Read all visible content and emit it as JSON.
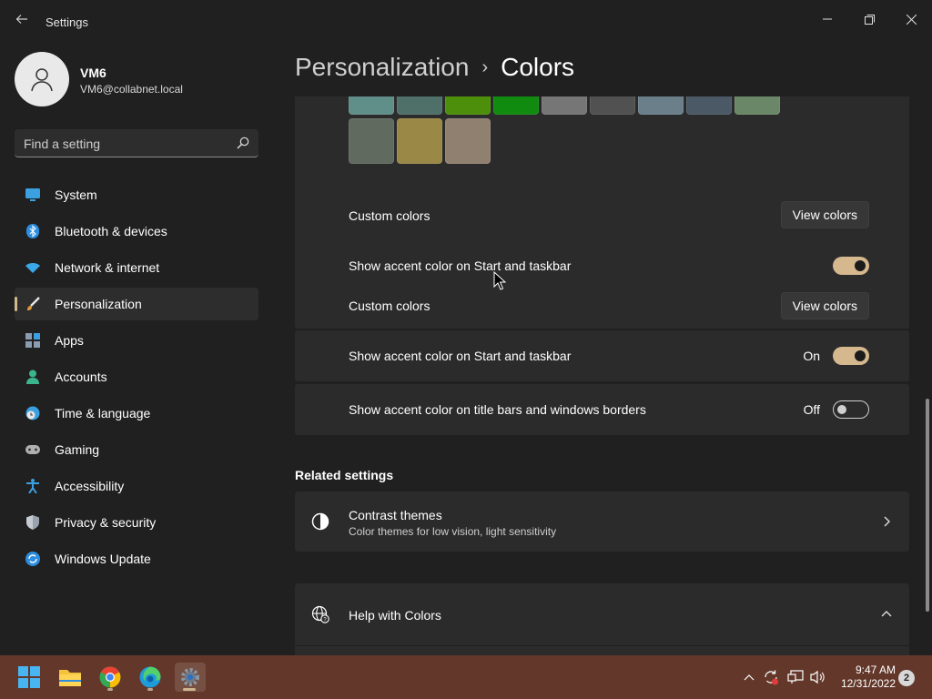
{
  "window": {
    "title": "Settings",
    "controls": [
      "minimize-icon",
      "maximize-icon",
      "close-icon"
    ]
  },
  "profile": {
    "name": "VM6",
    "email": "VM6@collabnet.local"
  },
  "search": {
    "placeholder": "Find a setting"
  },
  "sidebar": {
    "items": [
      {
        "label": "System",
        "icon": "monitor-icon",
        "active": false
      },
      {
        "label": "Bluetooth & devices",
        "icon": "bluetooth-icon",
        "active": false
      },
      {
        "label": "Network & internet",
        "icon": "wifi-icon",
        "active": false
      },
      {
        "label": "Personalization",
        "icon": "brush-icon",
        "active": true
      },
      {
        "label": "Apps",
        "icon": "apps-icon",
        "active": false
      },
      {
        "label": "Accounts",
        "icon": "person-icon",
        "active": false
      },
      {
        "label": "Time & language",
        "icon": "globe-clock-icon",
        "active": false
      },
      {
        "label": "Gaming",
        "icon": "gamepad-icon",
        "active": false
      },
      {
        "label": "Accessibility",
        "icon": "accessibility-icon",
        "active": false
      },
      {
        "label": "Privacy & security",
        "icon": "shield-icon",
        "active": false
      },
      {
        "label": "Windows Update",
        "icon": "update-icon",
        "active": false
      }
    ]
  },
  "breadcrumb": {
    "parent": "Personalization",
    "separator": "›",
    "current": "Colors"
  },
  "accent_swatches": [
    "#5f8f88",
    "#4e7069",
    "#4d8f0b",
    "#118a10",
    "#767676",
    "#515151",
    "#6b7f8b",
    "#4b5966",
    "#6a8868",
    "#606a5f",
    "#9a8847",
    "#8f8070"
  ],
  "settings": {
    "custom_colors_label": "Custom colors",
    "view_colors_button": "View colors",
    "ghost_toggle_label": "Show accent color on Start and taskbar",
    "custom_colors_label_2": "Custom colors",
    "view_colors_button_2": "View colors",
    "start_taskbar_label": "Show accent color on Start and taskbar",
    "start_taskbar_state": "On",
    "title_bars_label": "Show accent color on title bars and windows borders",
    "title_bars_state": "Off"
  },
  "related": {
    "section_title": "Related settings",
    "contrast_title": "Contrast themes",
    "contrast_sub": "Color themes for low vision, light sensitivity",
    "help_title": "Help with Colors"
  },
  "taskbar": {
    "apps": [
      "windows-start-icon",
      "file-explorer-icon",
      "chrome-icon",
      "edge-icon",
      "settings-icon"
    ],
    "time": "9:47 AM",
    "date": "12/31/2022",
    "notifications": "2"
  },
  "colors": {
    "accent": "#d6b88f",
    "taskbar": "#63382a",
    "background": "#202020",
    "card": "#2b2b2b"
  }
}
